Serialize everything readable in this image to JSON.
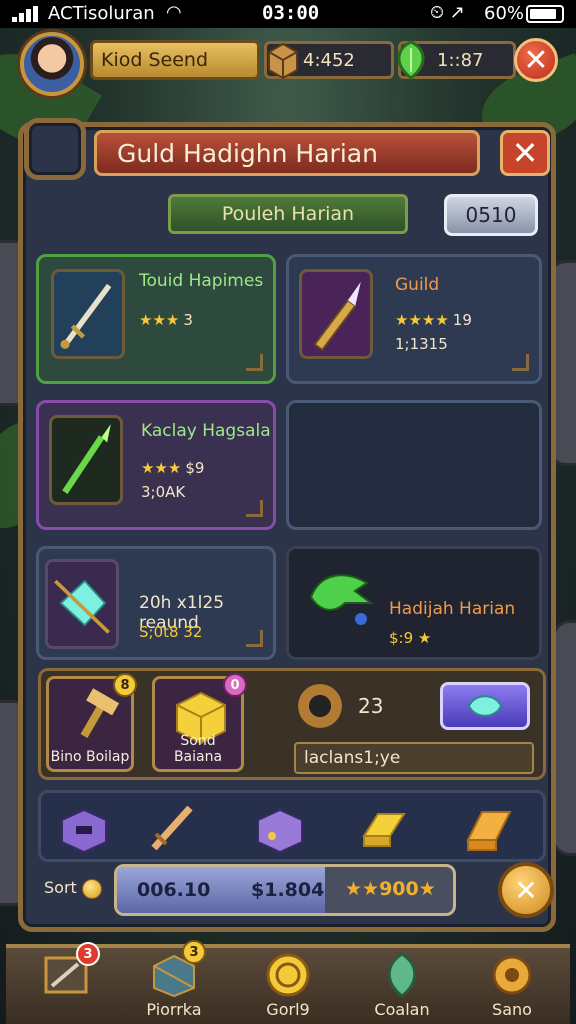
{
  "status_bar": {
    "carrier": "ACTisoluran",
    "time": "03:00",
    "battery": "60%"
  },
  "top_bar": {
    "player_name": "Kiod Seend",
    "resource_1": "4:452",
    "resource_2": "1::87"
  },
  "panel": {
    "title": "Guld   Hadighn Harian",
    "subtitle": "Pouleh Harian",
    "code": "0510"
  },
  "cards": [
    {
      "name": "Touid Hapimes",
      "stars": 3,
      "value": "3",
      "sub": ""
    },
    {
      "name": "Guild",
      "stars": 4,
      "value": "19",
      "sub": "1;1315"
    },
    {
      "name": "Kaclay Hagsala",
      "stars": 3,
      "value": "$9",
      "sub": "3;0AK"
    },
    {
      "name": "",
      "stars": 0,
      "value": "",
      "sub": ""
    },
    {
      "name": "20h x1l25 reaund",
      "stars": 0,
      "value": "",
      "sub": "S;0t8 32"
    },
    {
      "name": "Hadijah Harian",
      "stars": 1,
      "value": "$:9",
      "sub": ""
    }
  ],
  "items": {
    "item_1_label": "Bino Boilap",
    "item_1_badge": "8",
    "item_2_label": "Sond Baiana",
    "item_2_badge": "0",
    "timer_value": "23",
    "field_text": "laclans1;ye"
  },
  "progress": {
    "gold_label": "Sort",
    "value_1": "006.10",
    "value_2": "$1.804",
    "stars_text": "★★900★",
    "fill_fraction": 0.62
  },
  "bottom_nav": [
    {
      "label": "",
      "badge": "3"
    },
    {
      "label": "Piorrka",
      "badge": "3"
    },
    {
      "label": "Gorl9",
      "badge": ""
    },
    {
      "label": "Coalan",
      "badge": ""
    },
    {
      "label": "Sano",
      "badge": ""
    }
  ],
  "colors": {
    "panel_border": "#8a6a3a",
    "title_red": "#b9503a",
    "accent_green": "#4ea33e",
    "accent_purple": "#8a4cab",
    "gold": "#f4c93a"
  }
}
